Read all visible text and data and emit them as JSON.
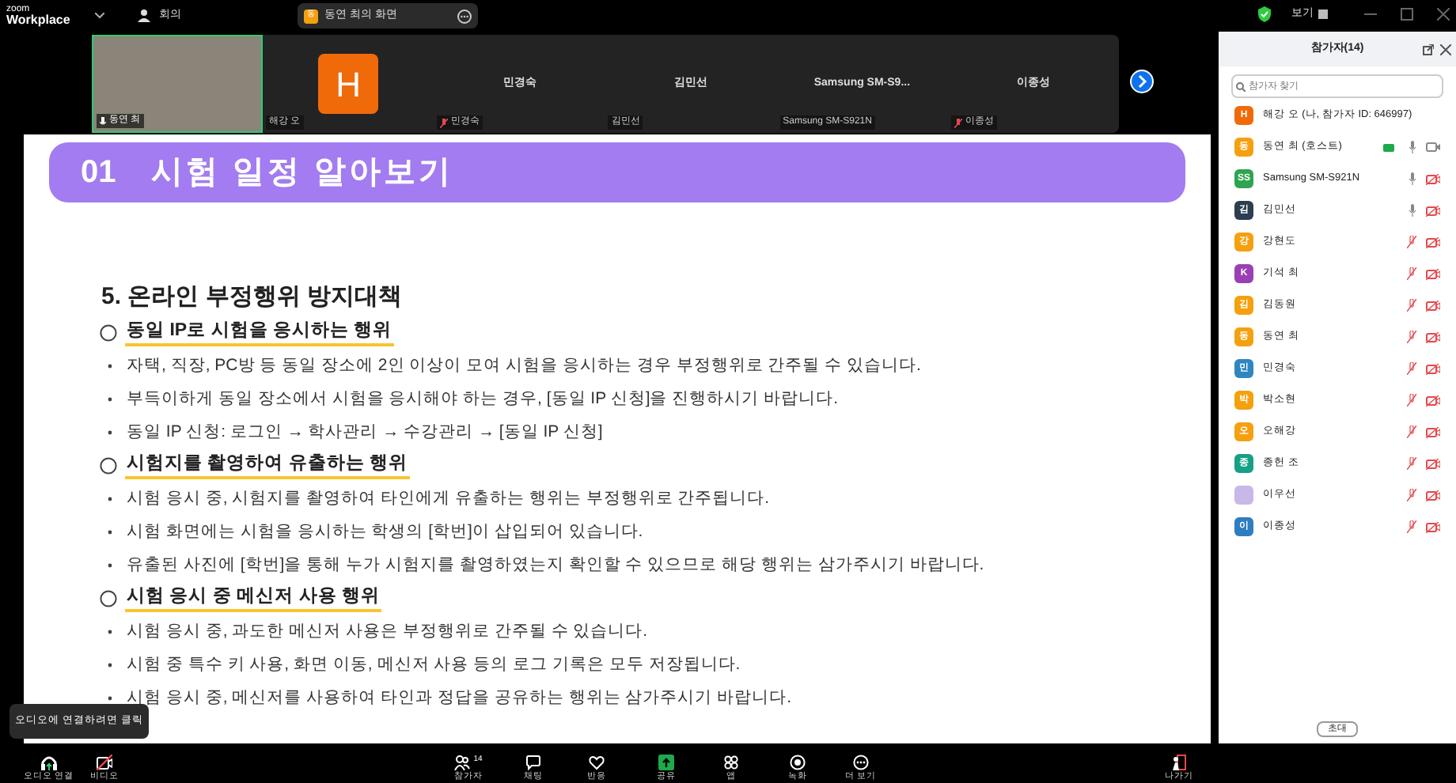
{
  "app": {
    "logo_top": "zoom",
    "logo_bottom": "Workplace",
    "meeting_label": "회의",
    "share_pill": {
      "avatar": "동",
      "text": "동연 최의 화면"
    },
    "view_label": "보기"
  },
  "gallery": {
    "video_tile": {
      "label": "동연 최"
    },
    "tiles": [
      {
        "kind": "avatar",
        "letter": "H",
        "label": "해강 오",
        "muted": false
      },
      {
        "kind": "name",
        "name": "민경숙",
        "label": "민경숙",
        "muted": true
      },
      {
        "kind": "name",
        "name": "김민선",
        "label": "김민선",
        "muted": false
      },
      {
        "kind": "name",
        "name": "Samsung  SM-S9...",
        "label": "Samsung SM-S921N",
        "muted": false
      },
      {
        "kind": "name",
        "name": "이종성",
        "label": "이종성",
        "muted": true
      }
    ]
  },
  "slide": {
    "banner_number": "01",
    "banner_title": "시험 일정 알아보기",
    "heading": "5. 온라인 부정행위 방지대책",
    "sections": [
      {
        "title": "동일 IP로 시험을 응시하는 행위",
        "bullets": [
          "자택, 직장, PC방 등 동일 장소에 2인 이상이 모여 시험을 응시하는 경우 부정행위로 간주될 수 있습니다.",
          "부득이하게 동일 장소에서 시험을 응시해야 하는 경우, [동일 IP 신청]을 진행하시기 바랍니다.",
          "동일 IP 신청: 로그인 → 학사관리 → 수강관리 → [동일 IP 신청]"
        ]
      },
      {
        "title": "시험지를 촬영하여 유출하는 행위",
        "bullets": [
          "시험 응시 중, 시험지를 촬영하여 타인에게 유출하는 행위는 부정행위로 간주됩니다.",
          "시험 화면에는 시험을 응시하는 학생의 [학번]이 삽입되어 있습니다.",
          "유출된 사진에 [학번]을 통해 누가 시험지를 촬영하였는지 확인할 수 있으므로 해당 행위는 삼가주시기 바랍니다."
        ]
      },
      {
        "title": "시험 응시 중 메신저 사용 행위",
        "bullets": [
          "시험 응시 중, 과도한 메신저 사용은 부정행위로 간주될 수 있습니다.",
          "시험 중 특수 키 사용, 화면 이동, 메신저 사용 등의 로그 기록은 모두 저장됩니다.",
          "시험 응시 중, 메신저를 사용하여 타인과 정답을 공유하는 행위는 삼가주시기 바랍니다."
        ]
      }
    ]
  },
  "participants": {
    "title": "참가자(14)",
    "search_placeholder": "참가자 찾기",
    "invite": "초대",
    "items": [
      {
        "name": "해강 오 (나, 참가자 ID: 646997)",
        "avatar": "H",
        "color": "#f06a0a"
      },
      {
        "name": "동연 최 (호스트)",
        "avatar": "동",
        "color": "#f5a00f",
        "mic_muted": false,
        "video_off": false,
        "sharing": true
      },
      {
        "name": "Samsung SM-S921N",
        "avatar": "SS",
        "color": "#2ea44f",
        "mic_muted": false,
        "video_off": true,
        "sharing": false
      },
      {
        "name": "김민선",
        "avatar": "김",
        "color": "#2c3e50",
        "mic_muted": false,
        "video_off": true,
        "sharing": false
      },
      {
        "name": "강현도",
        "avatar": "강",
        "color": "#f5a00f",
        "mic_muted": true,
        "video_off": true,
        "sharing": false
      },
      {
        "name": "기석 최",
        "avatar": "K",
        "color": "#9b3fb5",
        "mic_muted": true,
        "video_off": true,
        "sharing": false
      },
      {
        "name": "김동원",
        "avatar": "김",
        "color": "#f5a00f",
        "mic_muted": true,
        "video_off": true,
        "sharing": false
      },
      {
        "name": "동연 최",
        "avatar": "동",
        "color": "#f5a00f",
        "mic_muted": true,
        "video_off": true,
        "sharing": false
      },
      {
        "name": "민경숙",
        "avatar": "민",
        "color": "#2e86c1",
        "mic_muted": true,
        "video_off": true,
        "sharing": false
      },
      {
        "name": "박소현",
        "avatar": "박",
        "color": "#f5a00f",
        "mic_muted": true,
        "video_off": true,
        "sharing": false
      },
      {
        "name": "오해강",
        "avatar": "오",
        "color": "#f5a00f",
        "mic_muted": true,
        "video_off": true,
        "sharing": false
      },
      {
        "name": "종헌 조",
        "avatar": "종",
        "color": "#16a085",
        "mic_muted": true,
        "video_off": true,
        "sharing": false
      },
      {
        "name": "이우선",
        "color": "#c7b8e8",
        "mic_muted": true,
        "video_off": true,
        "sharing": false
      },
      {
        "name": "이종성",
        "avatar": "이",
        "color": "#2e7dc1",
        "mic_muted": true,
        "video_off": true,
        "sharing": false
      }
    ]
  },
  "tooltip": "오디오에 연결하려면 클릭",
  "toolbar": [
    {
      "kind": "audio",
      "label": "오디오 연결"
    },
    {
      "kind": "video",
      "label": "비디오"
    },
    {
      "kind": "participants",
      "label": "참가자",
      "count": "14"
    },
    {
      "kind": "chat",
      "label": "채팅"
    },
    {
      "kind": "react",
      "label": "반응"
    },
    {
      "kind": "share",
      "label": "공유"
    },
    {
      "kind": "apps",
      "label": "앱"
    },
    {
      "kind": "record",
      "label": "녹화"
    },
    {
      "kind": "more",
      "label": "더 보기"
    },
    {
      "kind": "leave",
      "label": "나가기"
    }
  ]
}
